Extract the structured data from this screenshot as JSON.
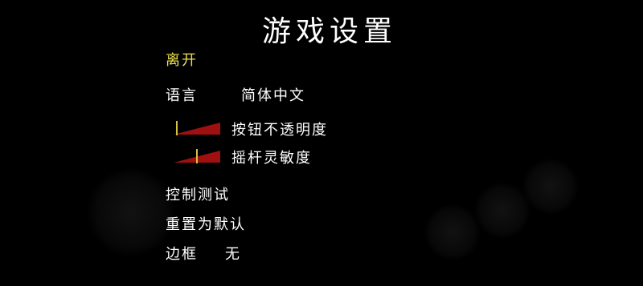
{
  "title": "游戏设置",
  "menu": {
    "leave": "离开",
    "language_label": "语言",
    "language_value": "简体中文",
    "button_opacity_label": "按钮不透明度",
    "button_opacity_value": 0.05,
    "stick_sensitivity_label": "摇杆灵敏度",
    "stick_sensitivity_value": 0.5,
    "control_test": "控制测试",
    "reset_default": "重置为默认",
    "border_label": "边框",
    "border_value": "无"
  },
  "colors": {
    "background": "#000000",
    "text": "#ffffff",
    "highlight": "#f0e050",
    "slider_fill": "#a01010",
    "slider_knob": "#d8c040"
  }
}
